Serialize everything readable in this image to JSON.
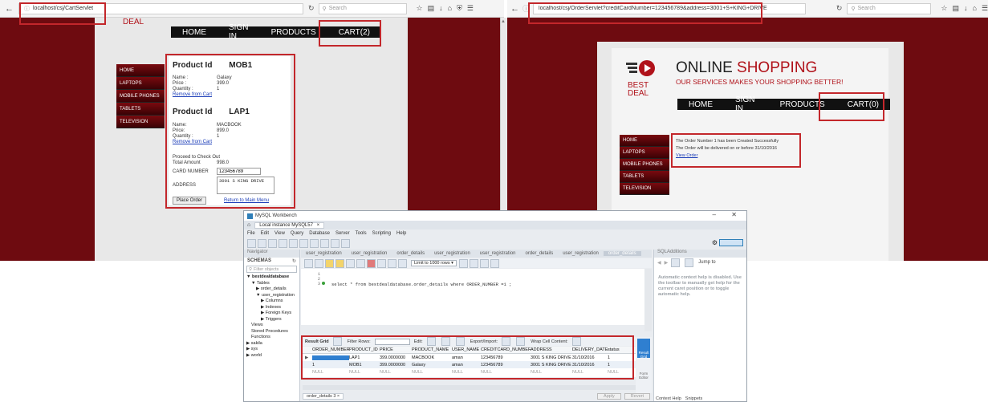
{
  "left_browser": {
    "url": "localhost/csj/CartServlet",
    "search_placeholder": "Search",
    "brand_partial": "DEAL",
    "nav": [
      "HOME",
      "SIGN IN",
      "PRODUCTS",
      "CART(2)"
    ],
    "sidebar": [
      "HOME",
      "LAPTOPS",
      "MOBILE PHONES",
      "TABLETS",
      "TELEVISION"
    ],
    "products": [
      {
        "id_label": "Product Id",
        "id": "MOB1",
        "name_label": "Name :",
        "name": "Galaxy",
        "price_label": "Price :",
        "price": "399.0",
        "qty_label": "Quantity :",
        "qty": "1",
        "remove": "Remove from Cart"
      },
      {
        "id_label": "Product Id",
        "id": "LAP1",
        "name_label": "Name:",
        "name": "MACBOOK",
        "price_label": "Price:",
        "price": "899.0",
        "qty_label": "Quantity :",
        "qty": "1",
        "remove": "Remove from Cart"
      }
    ],
    "checkout": {
      "heading": "Proceed to Check Out",
      "total_label": "Total Amount",
      "total": "998.0",
      "card_label": "CARD NUMBER",
      "card": "123456789",
      "address_label": "ADDRESS",
      "address": "3001 S KING DRIVE",
      "place_order": "Place Order",
      "return_link": "Return to Main Menu"
    }
  },
  "right_browser": {
    "url": "localhost/csj/OrderServlet?creditCardNumber=123456789&address=3001+S+KING+DRIVE",
    "search_placeholder": "Search",
    "brand": {
      "line1": "BEST",
      "line2": "DEAL"
    },
    "title_a": "ONLINE",
    "title_b": "SHOPPING",
    "tagline": "OUR SERVICES MAKES YOUR SHOPPING BETTER!",
    "nav": [
      "HOME",
      "SIGN IN",
      "PRODUCTS",
      "CART(0)"
    ],
    "sidebar": [
      "HOME",
      "LAPTOPS",
      "MOBILE PHONES",
      "TABLETS",
      "TELEVISION"
    ],
    "order_msg1": "The Order Number 1 has been Created Successfully",
    "order_msg2": "The Order will be delivered on or before 31/10/2016",
    "view_order": "View Order"
  },
  "workbench": {
    "title": "MySQL Workbench",
    "instance_tab": "Local instance MySQL57",
    "menu": [
      "File",
      "Edit",
      "View",
      "Query",
      "Database",
      "Server",
      "Tools",
      "Scripting",
      "Help"
    ],
    "navigator": "Navigator",
    "schemas": "SCHEMAS",
    "filter_placeholder": "Filter objects",
    "tree": [
      "bestdealdatabase",
      "Tables",
      "order_details",
      "user_registration",
      "Columns",
      "Indexes",
      "Foreign Keys",
      "Triggers",
      "Views",
      "Stored Procedures",
      "Functions",
      "sakila",
      "sys",
      "world"
    ],
    "editor_tabs": [
      "user_registration",
      "user_registration",
      "order_details",
      "user_registration",
      "user_registration",
      "order_details",
      "user_registration",
      "order_details"
    ],
    "limit": "Limit to 1000 rows",
    "line_numbers": [
      "1",
      "2",
      "3"
    ],
    "query": "select * from bestdealdatabase.order_details where ORDER_NUMBER =1 ;",
    "sql_additions": "SQLAdditions",
    "jump_to": "Jump to",
    "help_text": "Automatic context help is disabled. Use the toolbar to manually get help for the current caret position or to toggle automatic help.",
    "result_toolbar": {
      "result_grid": "Result Grid",
      "filter_rows": "Filter Rows:",
      "edit": "Edit:",
      "export": "Export/Import:",
      "wrap": "Wrap Cell Content:"
    },
    "columns": [
      "ORDER_NUMBER",
      "PRODUCT_ID",
      "PRICE",
      "PRODUCT_NAME",
      "USER_NAME",
      "CREDITCARD_NUMBER",
      "ADDRESS",
      "DELIVERY_DATE",
      "status"
    ],
    "rows": [
      [
        "1",
        "LAP1",
        "399.0000000",
        "MACBOOK",
        "aman",
        "123456789",
        "3001 S KING DRIVE",
        "31/10/2016",
        "1"
      ],
      [
        "1",
        "MOB1",
        "399.0000000",
        "Galaxy",
        "aman",
        "123456789",
        "3001 S KING DRIVE",
        "31/10/2016",
        "1"
      ],
      [
        "NULL",
        "NULL",
        "NULL",
        "NULL",
        "NULL",
        "NULL",
        "NULL",
        "NULL",
        "NULL"
      ]
    ],
    "bottom_tab": "order_details 3",
    "side_labels": [
      "Result Grid",
      "Form Editor"
    ],
    "apply": "Apply",
    "revert": "Revert",
    "help_tabs": [
      "Context Help",
      "Snippets"
    ]
  }
}
